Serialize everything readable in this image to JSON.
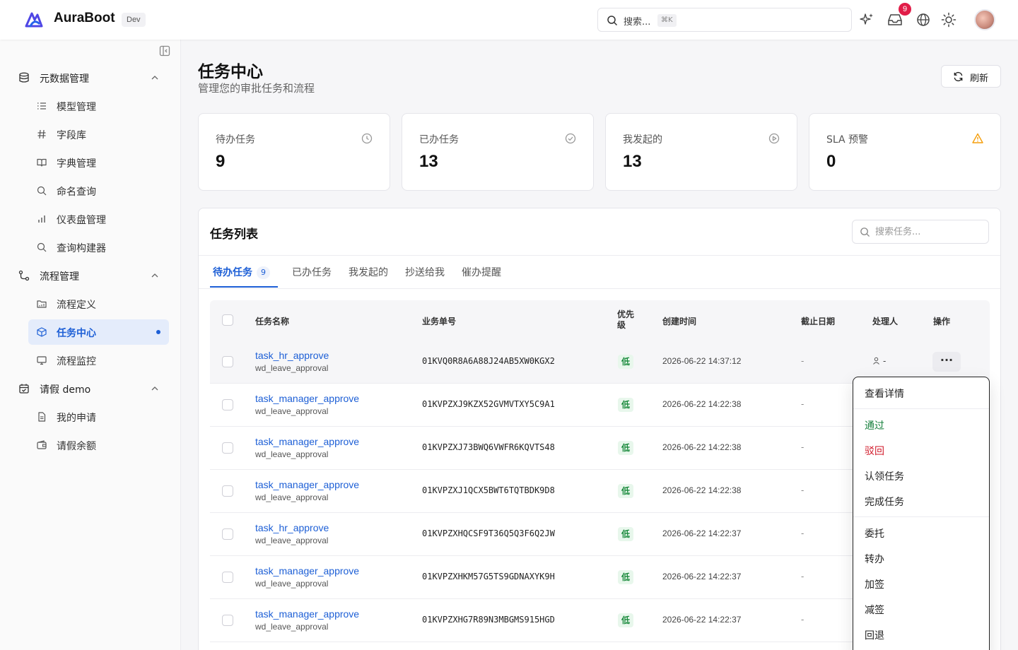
{
  "header": {
    "brand": "AuraBoot",
    "env_badge": "Dev",
    "search_placeholder": "搜索...",
    "search_shortcut": "⌘K",
    "notification_count": "9"
  },
  "sidebar": {
    "groups": [
      {
        "label": "元数据管理",
        "items": [
          {
            "label": "模型管理",
            "icon": "list-icon"
          },
          {
            "label": "字段库",
            "icon": "hash-icon"
          },
          {
            "label": "字典管理",
            "icon": "book-icon"
          },
          {
            "label": "命名查询",
            "icon": "search-icon"
          },
          {
            "label": "仪表盘管理",
            "icon": "bar-chart-icon"
          },
          {
            "label": "查询构建器",
            "icon": "search-icon"
          }
        ]
      },
      {
        "label": "流程管理",
        "items": [
          {
            "label": "流程定义",
            "icon": "folder-icon"
          },
          {
            "label": "任务中心",
            "icon": "cube-icon",
            "active": true
          },
          {
            "label": "流程监控",
            "icon": "monitor-icon"
          }
        ]
      },
      {
        "label": "请假 demo",
        "items": [
          {
            "label": "我的申请",
            "icon": "file-icon"
          },
          {
            "label": "请假余额",
            "icon": "wallet-icon"
          }
        ]
      }
    ]
  },
  "page": {
    "title": "任务中心",
    "subtitle": "管理您的审批任务和流程",
    "refresh_label": "刷新"
  },
  "stats": [
    {
      "label": "待办任务",
      "value": "9",
      "icon": "clock-icon"
    },
    {
      "label": "已办任务",
      "value": "13",
      "icon": "check-circle-icon"
    },
    {
      "label": "我发起的",
      "value": "13",
      "icon": "play-circle-icon"
    },
    {
      "label": "SLA 预警",
      "value": "0",
      "icon": "warning-icon",
      "icon_color": "#f59e0b"
    }
  ],
  "task_list": {
    "title": "任务列表",
    "search_placeholder": "搜索任务...",
    "tabs": [
      {
        "label": "待办任务",
        "count": "9",
        "active": true
      },
      {
        "label": "已办任务"
      },
      {
        "label": "我发起的"
      },
      {
        "label": "抄送给我"
      },
      {
        "label": "催办提醒"
      }
    ],
    "columns": [
      "任务名称",
      "业务单号",
      "优先级",
      "创建时间",
      "截止日期",
      "处理人",
      "操作"
    ],
    "rows": [
      {
        "name": "task_hr_approve",
        "key": "wd_leave_approval",
        "biz_no": "01KVQ0R8A6A88J24AB5XW0KGX2",
        "priority": "低",
        "created": "2026-06-22 14:37:12",
        "deadline": "-",
        "assignee": "-"
      },
      {
        "name": "task_manager_approve",
        "key": "wd_leave_approval",
        "biz_no": "01KVPZXJ9KZX52GVMVTXY5C9A1",
        "priority": "低",
        "created": "2026-06-22 14:22:38",
        "deadline": "-"
      },
      {
        "name": "task_manager_approve",
        "key": "wd_leave_approval",
        "biz_no": "01KVPZXJ73BWQ6VWFR6KQVTS48",
        "priority": "低",
        "created": "2026-06-22 14:22:38",
        "deadline": "-"
      },
      {
        "name": "task_manager_approve",
        "key": "wd_leave_approval",
        "biz_no": "01KVPZXJ1QCX5BWT6TQTBDK9D8",
        "priority": "低",
        "created": "2026-06-22 14:22:38",
        "deadline": "-"
      },
      {
        "name": "task_hr_approve",
        "key": "wd_leave_approval",
        "biz_no": "01KVPZXHQCSF9T36Q5Q3F6Q2JW",
        "priority": "低",
        "created": "2026-06-22 14:22:37",
        "deadline": "-"
      },
      {
        "name": "task_manager_approve",
        "key": "wd_leave_approval",
        "biz_no": "01KVPZXHKM57G5TS9GDNAXYK9H",
        "priority": "低",
        "created": "2026-06-22 14:22:37",
        "deadline": "-"
      },
      {
        "name": "task_manager_approve",
        "key": "wd_leave_approval",
        "biz_no": "01KVPZXHG7R89N3MBGMS915HGD",
        "priority": "低",
        "created": "2026-06-22 14:22:37",
        "deadline": "-"
      }
    ]
  },
  "action_menu": {
    "items": [
      {
        "label": "查看详情"
      },
      {
        "label": "通过",
        "color": "#17803d"
      },
      {
        "label": "驳回",
        "color": "#d11a2a"
      },
      {
        "label": "认领任务"
      },
      {
        "label": "完成任务"
      },
      {
        "label": "委托"
      },
      {
        "label": "转办"
      },
      {
        "label": "加签"
      },
      {
        "label": "减签"
      },
      {
        "label": "回退"
      }
    ]
  },
  "colors": {
    "accent": "#1d5fd6",
    "priority_low_bg": "#e8f7ec",
    "priority_low_text": "#1a8a3c",
    "badge": "#e11d48"
  }
}
